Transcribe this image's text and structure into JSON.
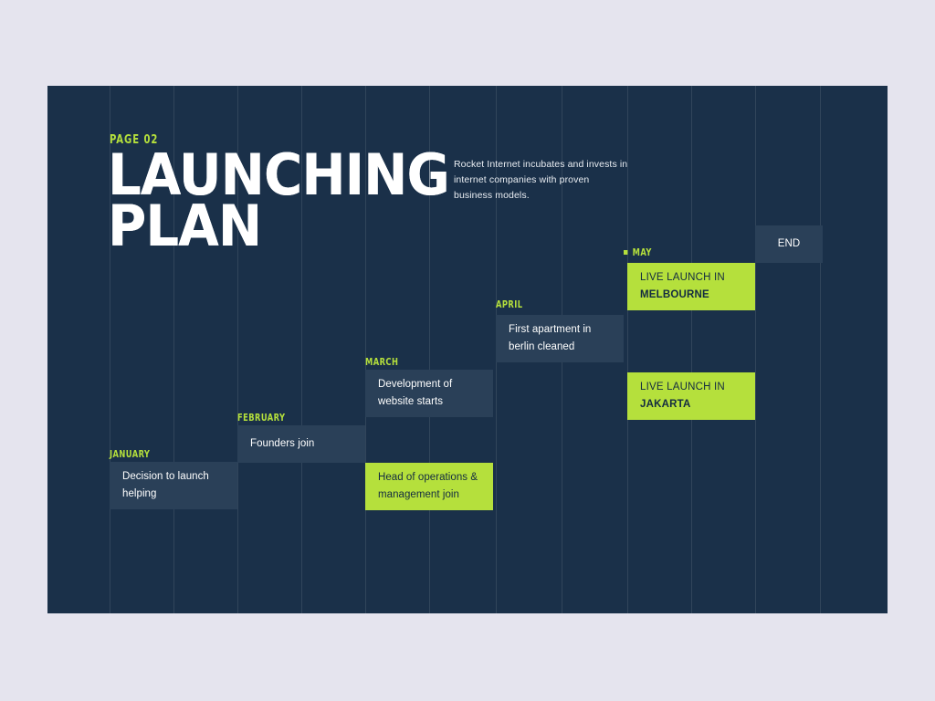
{
  "canvas": {
    "bg_color": "#1A3049",
    "page_bg_color": "#E5E4EE",
    "accent_color": "#B5E03C",
    "card_color": "#2A4058"
  },
  "header": {
    "page_label": "PAGE 02",
    "title_line1": "LAUNCHING",
    "title_line2": "PLAN",
    "intro": "Rocket Internet incubates and invests in internet companies with proven business models."
  },
  "timeline": {
    "months": [
      {
        "label": "JANUARY",
        "has_bullet": false
      },
      {
        "label": "FEBRUARY",
        "has_bullet": false
      },
      {
        "label": "MARCH",
        "has_bullet": false
      },
      {
        "label": "APRIL",
        "has_bullet": false
      },
      {
        "label": "MAY",
        "has_bullet": true
      }
    ],
    "cards": [
      {
        "line1": "Decision to launch",
        "line2": "helping",
        "style": "dark"
      },
      {
        "line1": "Founders join",
        "line2": "",
        "style": "dark"
      },
      {
        "line1": "Development of",
        "line2": "website starts",
        "style": "dark"
      },
      {
        "line1": "Head of operations &",
        "line2": "management join",
        "style": "green"
      },
      {
        "line1": "First apartment in",
        "line2": "berlin cleaned",
        "style": "dark"
      },
      {
        "line1": "LIVE LAUNCH IN",
        "line2": "MELBOURNE",
        "style": "green"
      },
      {
        "line1": "LIVE LAUNCH IN",
        "line2": "JAKARTA",
        "style": "green"
      }
    ],
    "end_label": "END"
  }
}
